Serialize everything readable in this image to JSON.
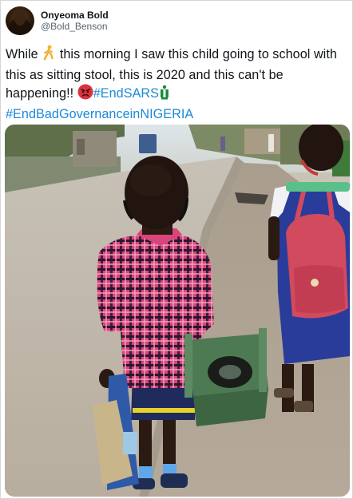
{
  "user": {
    "display_name": "Onyeoma Bold",
    "handle": "@Bold_Benson"
  },
  "tweet": {
    "text_part1": "While ",
    "text_part2": " this morning I saw this child going to school with this as sitting stool, this is 2020 and this can't be happening!! ",
    "hashtag_endsars": "#EndSARS",
    "hashtag_endbadgovernance": "#EndBadGovernanceinNIGERIA",
    "emojis": [
      "walking-person-emoji",
      "angry-face-emoji",
      "nigeria-flag-emoji"
    ]
  },
  "media": {
    "type": "photo"
  },
  "colors": {
    "link": "#1b8ad8",
    "text": "#0f1419",
    "secondary": "#536471"
  }
}
